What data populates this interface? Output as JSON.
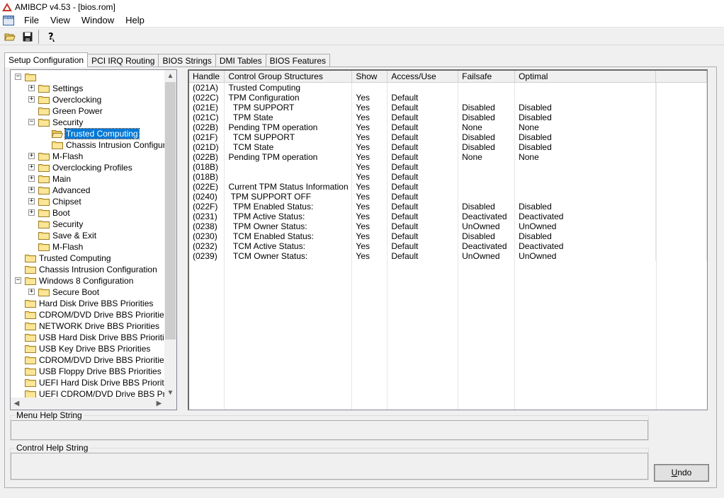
{
  "window": {
    "title": "AMIBCP v4.53 - [bios.rom]"
  },
  "menubar": {
    "items": [
      "File",
      "View",
      "Window",
      "Help"
    ]
  },
  "toolbar": {
    "buttons": [
      "open-icon",
      "save-icon",
      "help-icon"
    ]
  },
  "tabs": [
    {
      "label": "Setup Configuration",
      "active": true
    },
    {
      "label": "PCI IRQ Routing",
      "active": false
    },
    {
      "label": "BIOS Strings",
      "active": false
    },
    {
      "label": "DMI Tables",
      "active": false
    },
    {
      "label": "BIOS Features",
      "active": false
    }
  ],
  "tree": {
    "nodes": [
      {
        "label": "",
        "depth": 0,
        "expander": "-"
      },
      {
        "label": "Settings",
        "depth": 1,
        "expander": "+"
      },
      {
        "label": "Overclocking",
        "depth": 1,
        "expander": "+"
      },
      {
        "label": "Green Power",
        "depth": 1,
        "expander": ""
      },
      {
        "label": "Security",
        "depth": 1,
        "expander": "-"
      },
      {
        "label": "Trusted Computing",
        "depth": 2,
        "expander": "",
        "selected": true
      },
      {
        "label": "Chassis Intrusion Configuratio",
        "depth": 2,
        "expander": ""
      },
      {
        "label": "M-Flash",
        "depth": 1,
        "expander": "+"
      },
      {
        "label": "Overclocking Profiles",
        "depth": 1,
        "expander": "+"
      },
      {
        "label": "Main",
        "depth": 1,
        "expander": "+"
      },
      {
        "label": "Advanced",
        "depth": 1,
        "expander": "+"
      },
      {
        "label": "Chipset",
        "depth": 1,
        "expander": "+"
      },
      {
        "label": "Boot",
        "depth": 1,
        "expander": "+"
      },
      {
        "label": "Security",
        "depth": 1,
        "expander": ""
      },
      {
        "label": "Save & Exit",
        "depth": 1,
        "expander": ""
      },
      {
        "label": "M-Flash",
        "depth": 1,
        "expander": ""
      },
      {
        "label": "Trusted Computing",
        "depth": 0,
        "expander": ""
      },
      {
        "label": "Chassis Intrusion Configuration",
        "depth": 0,
        "expander": ""
      },
      {
        "label": "Windows 8 Configuration",
        "depth": 0,
        "expander": "-"
      },
      {
        "label": "Secure Boot",
        "depth": 1,
        "expander": "+"
      },
      {
        "label": "Hard Disk Drive BBS Priorities",
        "depth": 0,
        "expander": ""
      },
      {
        "label": "CDROM/DVD Drive BBS Priorities",
        "depth": 0,
        "expander": ""
      },
      {
        "label": "NETWORK Drive BBS Priorities",
        "depth": 0,
        "expander": ""
      },
      {
        "label": "USB Hard Disk Drive BBS Priorities",
        "depth": 0,
        "expander": ""
      },
      {
        "label": "USB Key Drive BBS Priorities",
        "depth": 0,
        "expander": ""
      },
      {
        "label": "CDROM/DVD Drive BBS Priorities",
        "depth": 0,
        "expander": ""
      },
      {
        "label": "USB Floppy Drive BBS Priorities",
        "depth": 0,
        "expander": ""
      },
      {
        "label": "UEFI Hard Disk Drive BBS Priorities",
        "depth": 0,
        "expander": ""
      },
      {
        "label": "UEFI CDROM/DVD Drive BBS Priorit",
        "depth": 0,
        "expander": ""
      }
    ]
  },
  "grid": {
    "columns": [
      "Handle",
      "Control Group Structures",
      "Show",
      "Access/Use",
      "Failsafe",
      "Optimal"
    ],
    "rows": [
      [
        "(021A)",
        "Trusted Computing",
        "",
        "",
        "",
        ""
      ],
      [
        "(022C)",
        "TPM Configuration",
        "Yes",
        "Default",
        "",
        ""
      ],
      [
        "(021E)",
        "  TPM SUPPORT",
        "Yes",
        "Default",
        "Disabled",
        "Disabled"
      ],
      [
        "(021C)",
        "  TPM State",
        "Yes",
        "Default",
        "Disabled",
        "Disabled"
      ],
      [
        "(022B)",
        "Pending TPM operation",
        "Yes",
        "Default",
        "None",
        "None"
      ],
      [
        "(021F)",
        "  TCM SUPPORT",
        "Yes",
        "Default",
        "Disabled",
        "Disabled"
      ],
      [
        "(021D)",
        "  TCM State",
        "Yes",
        "Default",
        "Disabled",
        "Disabled"
      ],
      [
        "(022B)",
        "Pending TPM operation",
        "Yes",
        "Default",
        "None",
        "None"
      ],
      [
        "(018B)",
        "",
        "Yes",
        "Default",
        "",
        ""
      ],
      [
        "(018B)",
        "",
        "Yes",
        "Default",
        "",
        ""
      ],
      [
        "(022E)",
        "Current TPM Status Information",
        "Yes",
        "Default",
        "",
        ""
      ],
      [
        "(0240)",
        " TPM SUPPORT OFF",
        "Yes",
        "Default",
        "",
        ""
      ],
      [
        "(022F)",
        "  TPM Enabled Status:",
        "Yes",
        "Default",
        "Disabled",
        "Disabled"
      ],
      [
        "(0231)",
        "  TPM Active Status:",
        "Yes",
        "Default",
        "Deactivated",
        "Deactivated"
      ],
      [
        "(0238)",
        "  TPM Owner Status:",
        "Yes",
        "Default",
        "UnOwned",
        "UnOwned"
      ],
      [
        "(0230)",
        "  TCM Enabled Status:",
        "Yes",
        "Default",
        "Disabled",
        "Disabled"
      ],
      [
        "(0232)",
        "  TCM Active Status:",
        "Yes",
        "Default",
        "Deactivated",
        "Deactivated"
      ],
      [
        "(0239)",
        "  TCM Owner Status:",
        "Yes",
        "Default",
        "UnOwned",
        "UnOwned"
      ]
    ]
  },
  "help": {
    "menu_label": "Menu Help String",
    "control_label": "Control Help String"
  },
  "buttons": {
    "undo_first": "U",
    "undo_rest": "ndo"
  },
  "colors": {
    "selection": "#0078d7",
    "folder": "#f5d870"
  }
}
